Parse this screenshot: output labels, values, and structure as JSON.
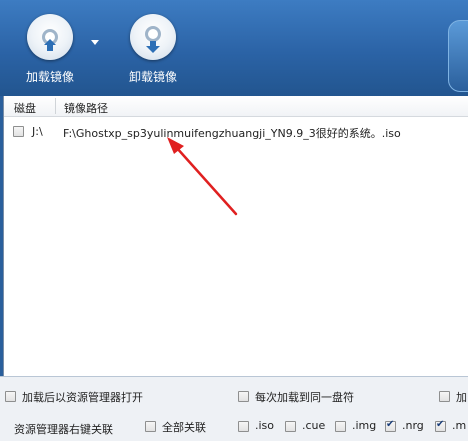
{
  "toolbar": {
    "load_label": "加载镜像",
    "unload_label": "卸载镜像"
  },
  "list": {
    "headers": {
      "disk": "磁盘",
      "path": "镜像路径"
    },
    "rows": [
      {
        "checked": false,
        "drive": "J:\\",
        "path": "F:\\Ghostxp_sp3yulinmuifengzhuangji_YN9.9_3很好的系统。.iso"
      }
    ]
  },
  "options": {
    "open_explorer": "加载后以资源管理器打开",
    "load_same": "每次加载到同一盘符",
    "load_third": "加",
    "context_menu_label": "资源管理器右键关联",
    "all_assoc": "全部关联",
    "ext": {
      "iso": ".iso",
      "cue": ".cue",
      "img": ".img",
      "nrg": ".nrg",
      "m": ".m"
    }
  },
  "colors": {
    "toolbar_bg": "#2b63a6",
    "arrow": "#e02020"
  }
}
